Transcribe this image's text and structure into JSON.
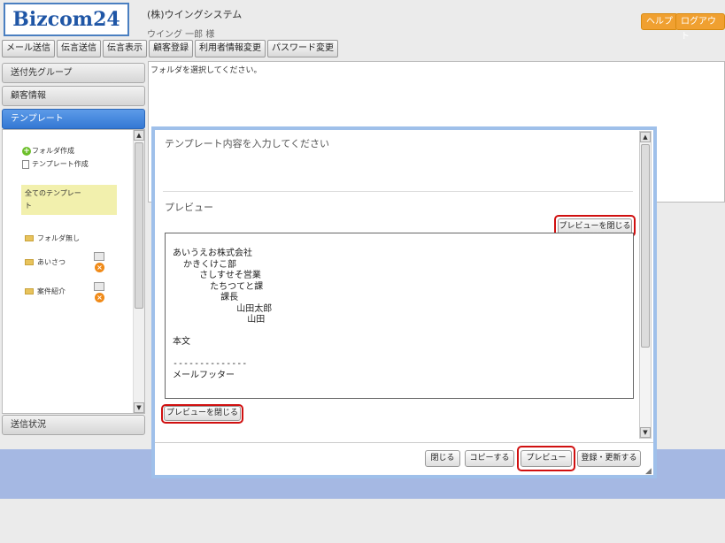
{
  "header": {
    "logo": "Bizcom24",
    "company": "(株)ウイングシステム",
    "user": "ウイング 一郎 様",
    "help": "ヘルプ",
    "logout": "ログアウト"
  },
  "menu": [
    "メール送信",
    "伝言送信",
    "伝言表示",
    "顧客登録",
    "利用者情報変更",
    "パスワード変更"
  ],
  "sidebar": {
    "groups": "送付先グループ",
    "customers": "顧客情報",
    "templates": "テンプレート",
    "status": "送信状況",
    "create_folder": "フォルダ作成",
    "create_template": "テンプレート作成",
    "all_templates": "全てのテンプレー\nト",
    "folders": [
      "フォルダ無し",
      "あいさつ",
      "案件紹介"
    ]
  },
  "main": {
    "message": "フォルダを選択してください。"
  },
  "dialog": {
    "input_prompt": "テンプレート内容を入力してください",
    "preview_label": "プレビュー",
    "close_preview": "プレビューを閉じる",
    "preview_text": "あいうえお株式会社\n  かきくけこ部\n     さしすせそ営業\n       たちつてと課\n         課長\n            山田太郎\n              山田\n\n本文\n\n--------------\nメールフッター",
    "buttons": {
      "close": "閉じる",
      "copy": "コピーする",
      "preview": "プレビュー",
      "save": "登録・更新する"
    }
  }
}
